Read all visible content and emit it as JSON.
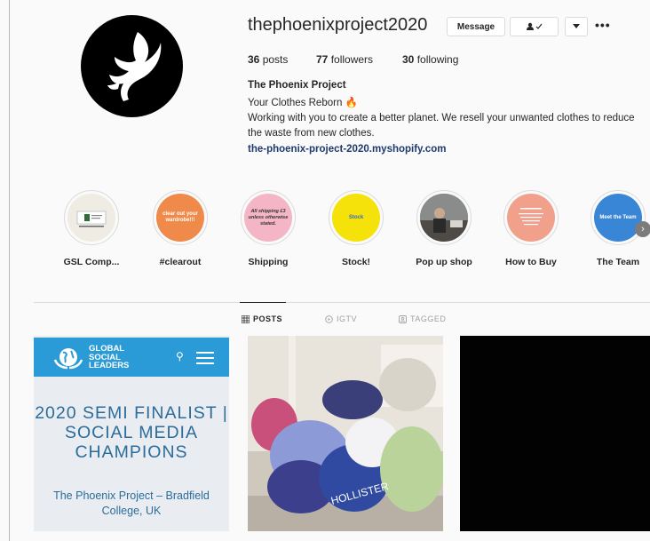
{
  "profile": {
    "username": "thephoenixproject2020",
    "message_label": "Message",
    "more_label": "•••",
    "stats": [
      {
        "value": "36",
        "label": "posts"
      },
      {
        "value": "77",
        "label": "followers"
      },
      {
        "value": "30",
        "label": "following"
      }
    ],
    "bio": {
      "name": "The Phoenix Project",
      "line1": "Your Clothes Reborn 🔥",
      "line2": "Working with you to create a better planet. We resell your unwanted clothes to reduce the waste from new clothes.",
      "link": "the-phoenix-project-2020.myshopify.com"
    }
  },
  "highlights": [
    {
      "label": "GSL Comp...",
      "bg": "#efece3",
      "fg": "#2f6a3a",
      "inner_text": ""
    },
    {
      "label": "#clearout",
      "bg": "#f08a4b",
      "fg": "#ffffff",
      "inner_text": "clear out your wardrobe!!!"
    },
    {
      "label": "Shipping",
      "bg": "#f4b5c6",
      "fg": "#333333",
      "inner_text": "All shipping £3 unless otherwise stated."
    },
    {
      "label": "Stock!",
      "bg": "#f4e20a",
      "fg": "#3d6bb7",
      "inner_text": "Stock"
    },
    {
      "label": "Pop up shop",
      "bg": "#6b6e6d",
      "fg": "#ffffff",
      "inner_text": ""
    },
    {
      "label": "How to Buy",
      "bg": "#f1a08b",
      "fg": "#ffffff",
      "inner_text": ""
    },
    {
      "label": "The Team",
      "bg": "#3a86d6",
      "fg": "#ffffff",
      "inner_text": "Meet the Team"
    }
  ],
  "tabs": [
    {
      "label": "POSTS",
      "icon": "grid-icon",
      "active": true
    },
    {
      "label": "IGTV",
      "icon": "igtv-icon",
      "active": false
    },
    {
      "label": "TAGGED",
      "icon": "tag-icon",
      "active": false
    }
  ],
  "posts": {
    "post1": {
      "brand": "GLOBAL\nSOCIAL\nLEADERS",
      "title": "2020 SEMI FINALIST | SOCIAL MEDIA CHAMPIONS",
      "subtitle": "The Phoenix Project – Bradfield College, UK"
    }
  },
  "colors": {
    "accent_link": "#1e3a6e",
    "gsl_blue": "#2b9bd7"
  }
}
